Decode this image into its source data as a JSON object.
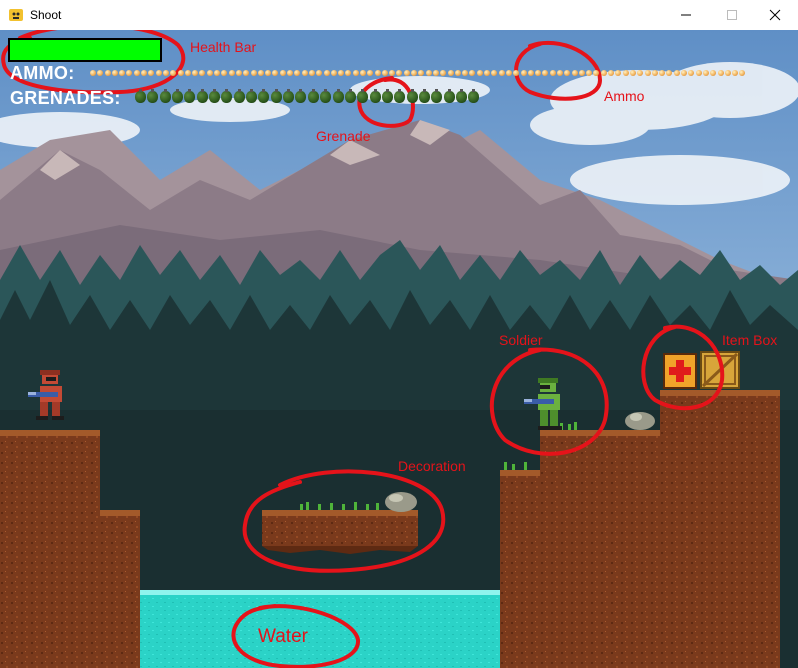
{
  "window": {
    "title": "Shoot",
    "minimize_icon": "minimize-icon",
    "maximize_icon": "maximize-icon",
    "close_icon": "close-icon"
  },
  "hud": {
    "health_fraction": 1.0,
    "health_color": "#00ff00",
    "health_bg_color": "#d40000",
    "ammo_label": "AMMO:",
    "ammo_count": 90,
    "grenade_label": "GRENADES:",
    "grenade_count": 28
  },
  "annotations": {
    "health_bar": "Health Bar",
    "ammo": "Ammo",
    "grenade": "Grenade",
    "soldier": "Soldier",
    "item_box": "Item Box",
    "decoration": "Decoration",
    "water": "Water",
    "color": "#e5131a"
  },
  "colors": {
    "sky": "#6e9ccd",
    "mountain": "#8b7a86",
    "forest": "#1f3b3a",
    "dirt": "#7a3a1c",
    "water": "#2bd3c7",
    "player": "#c34a35",
    "enemy": "#6bb13f"
  }
}
